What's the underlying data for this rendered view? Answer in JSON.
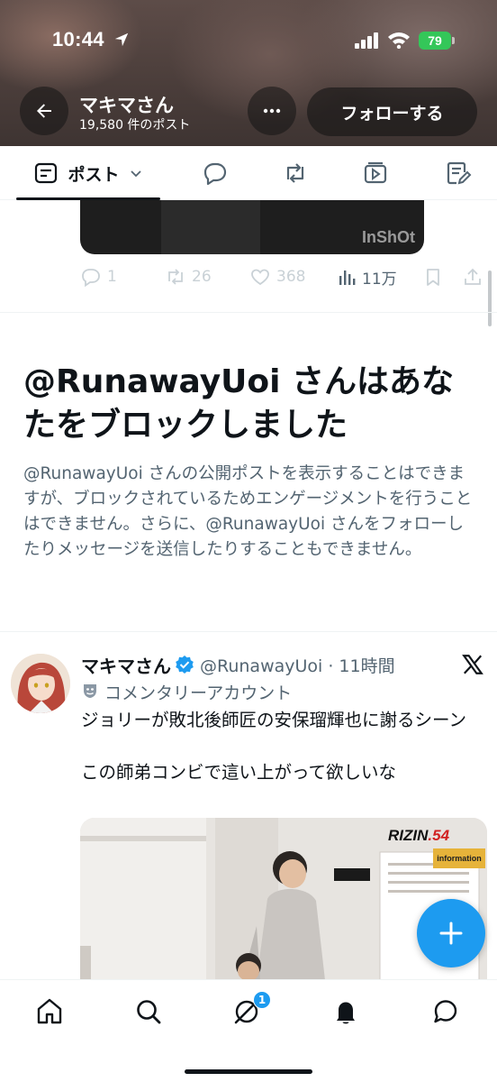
{
  "status_bar": {
    "time": "10:44",
    "battery": "79",
    "icons": [
      "location-arrow-icon",
      "cellular-signal-icon",
      "wifi-icon",
      "battery-icon"
    ]
  },
  "header": {
    "profile_name": "マキマさん",
    "post_count": "19,580 件のポスト",
    "follow_label": "フォローする",
    "icons": [
      "back-arrow-icon",
      "more-dots-icon"
    ]
  },
  "tabs": {
    "active_label": "ポスト",
    "icons": [
      "posts-icon",
      "chevron-down-icon",
      "replies-icon",
      "reposts-icon",
      "media-icon",
      "articles-icon"
    ]
  },
  "previous_post": {
    "watermark": "InShOt",
    "replies": "1",
    "reposts": "26",
    "likes": "368",
    "views": "11万"
  },
  "block_notice": {
    "title": "@RunawayUoi さんはあなたをブロックしました",
    "description": "@RunawayUoi さんの公開ポストを表示することはできますが、ブロックされているためエンゲージメントを行うことはできません。さらに、@RunawayUoi さんをフォローしたりメッセージを送信したりすることもできません。"
  },
  "post": {
    "name": "マキマさん",
    "handle_time": "@RunawayUoi · 11時間",
    "commentary": "コメンタリーアカウント",
    "text": "ジョリーが敗北後師匠の安保瑠輝也に謝るシーン\n\nこの師弟コンビで這い上がって欲しいな",
    "media_brand": "RIZIN",
    "media_number": ".54",
    "media_sign": "information"
  },
  "colors": {
    "accent": "#1d9bf0",
    "text_primary": "#0f1419",
    "text_secondary": "#536471",
    "battery": "#34c759"
  },
  "bottom_nav": {
    "badge": "1",
    "icons": [
      "home-icon",
      "search-icon",
      "grok-icon",
      "notifications-bell-icon",
      "messages-icon"
    ]
  }
}
